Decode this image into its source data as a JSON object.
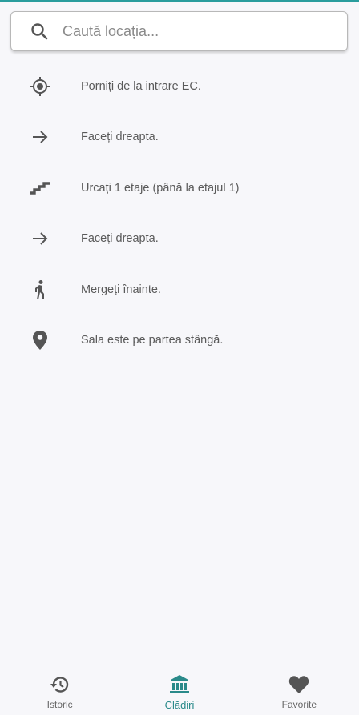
{
  "colors": {
    "accent": "#2a8a8a",
    "icon": "#555555",
    "background": "#f7f7fa"
  },
  "search": {
    "placeholder": "Caută locația...",
    "icon": "search-icon"
  },
  "steps": [
    {
      "icon": "my-location-icon",
      "text": "Porniți de la intrare EC."
    },
    {
      "icon": "arrow-right-icon",
      "text": "Faceți dreapta."
    },
    {
      "icon": "stairs-icon",
      "text": "Urcați 1 etaje (până la etajul 1)"
    },
    {
      "icon": "arrow-right-icon",
      "text": "Faceți dreapta."
    },
    {
      "icon": "walking-icon",
      "text": "Mergeți înainte."
    },
    {
      "icon": "location-pin-icon",
      "text": "Sala este pe partea stângă."
    }
  ],
  "bottom_nav": {
    "items": [
      {
        "label": "Istoric",
        "icon": "history-icon",
        "active": false
      },
      {
        "label": "Clădiri",
        "icon": "building-icon",
        "active": true
      },
      {
        "label": "Favorite",
        "icon": "heart-icon",
        "active": false
      }
    ]
  }
}
